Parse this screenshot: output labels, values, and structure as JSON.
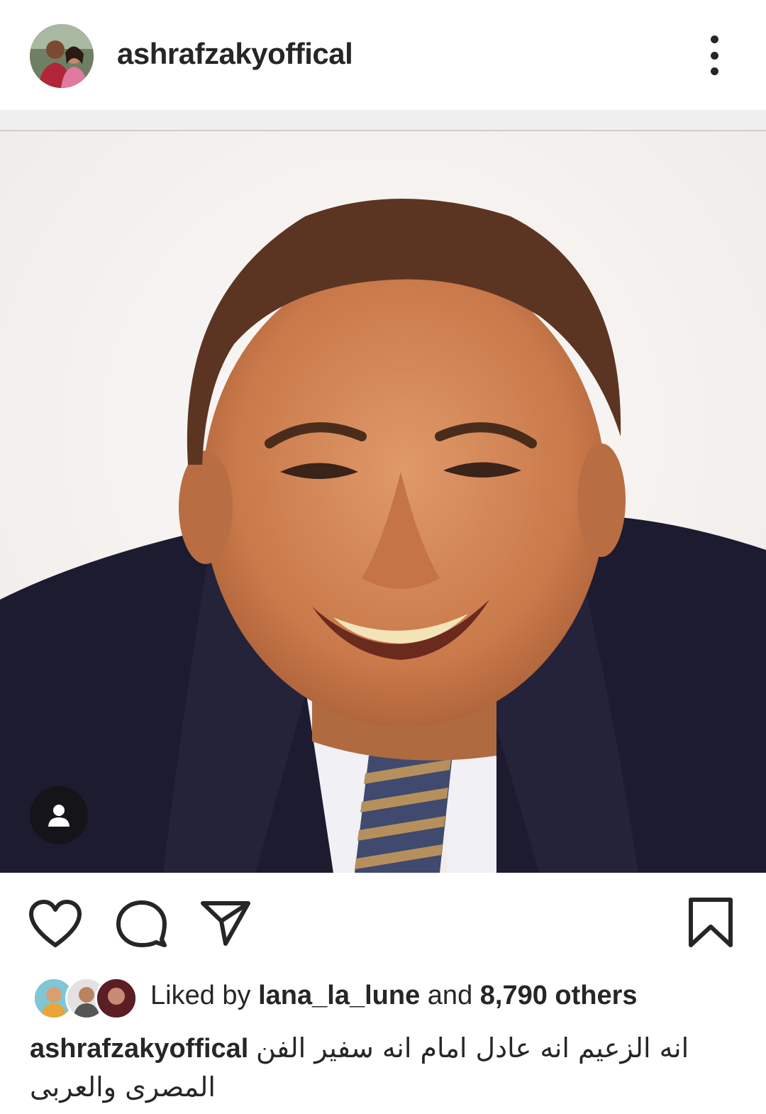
{
  "post": {
    "username": "ashrafzakyoffical",
    "avatar_icon": "profile-photo",
    "more_icon": "more-vertical-icon"
  },
  "actions": {
    "like_icon": "heart-icon",
    "comment_icon": "comment-icon",
    "share_icon": "send-icon",
    "save_icon": "bookmark-icon"
  },
  "likes": {
    "prefix": "Liked by",
    "user": "lana_la_lune",
    "conj": "and",
    "count": "8,790 others"
  },
  "caption": {
    "username": "ashrafzakyoffical",
    "line1": "انه الزعيم انه عادل امام انه سفير الفن",
    "line2": "المصرى والعربى"
  },
  "colors": {
    "text": "#262626",
    "divider": "#efefef",
    "tag_bg": "#1e1e1e"
  }
}
